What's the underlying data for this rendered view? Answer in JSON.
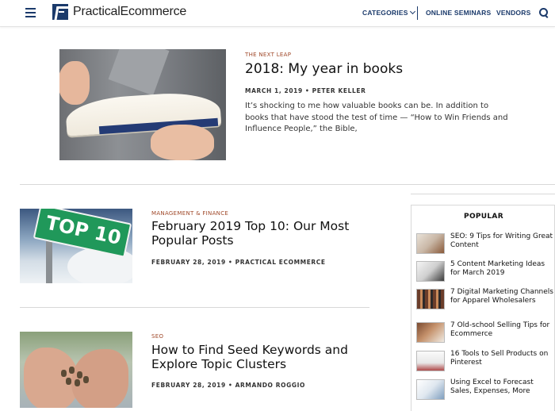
{
  "header": {
    "logo_text": "PracticalEcommerce",
    "nav": {
      "categories": "CATEGORIES",
      "online_seminars": "ONLINE SEMINARS",
      "vendors": "VENDORS"
    },
    "brand_color": "#1b3a6b"
  },
  "articles": [
    {
      "category": "THE NEXT LEAP",
      "title": "2018: My year in books",
      "meta": "MARCH 1, 2019 • PETER KELLER",
      "excerpt": "It’s shocking to me how valuable books can be. In addition to books that have stood the test of time — “How to Win Friends and Influence People,” the Bible,"
    },
    {
      "category": "MANAGEMENT & FINANCE",
      "title": "February 2019 Top 10: Our Most Popular Posts",
      "meta": "FEBRUARY 28, 2019 • PRACTICAL ECOMMERCE",
      "image_text": "TOP 10"
    },
    {
      "category": "SEO",
      "title": "How to Find Seed Keywords and Explore Topic Clusters",
      "meta": "FEBRUARY 28, 2019 • ARMANDO ROGGIO"
    }
  ],
  "popular": {
    "title": "POPULAR",
    "items": [
      {
        "label": "SEO: 9 Tips for Writing Great Content"
      },
      {
        "label": "5 Content Marketing Ideas for March 2019"
      },
      {
        "label": "7 Digital Marketing Channels for Apparel Wholesalers"
      },
      {
        "label": "7 Old-school Selling Tips for Ecommerce"
      },
      {
        "label": "16 Tools to Sell Products on Pinterest"
      },
      {
        "label": "Using Excel to Forecast Sales, Expenses, More"
      }
    ]
  },
  "colors": {
    "category": "#a0492a",
    "title": "#111111"
  }
}
